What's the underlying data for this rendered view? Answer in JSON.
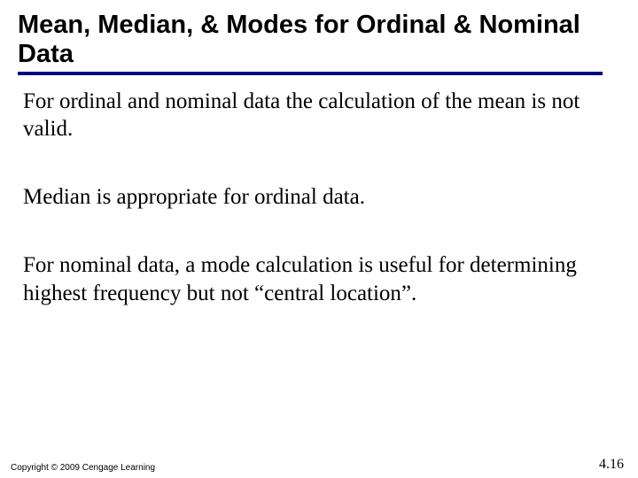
{
  "title": "Mean, Median, & Modes for Ordinal & Nominal Data",
  "paragraphs": {
    "p1": "For ordinal and nominal data the calculation of the mean is not valid.",
    "p2": "Median is appropriate for ordinal data.",
    "p3": "For nominal data, a mode calculation is useful for determining highest frequency but not “central location”."
  },
  "footer": {
    "copyright": "Copyright © 2009 Cengage Learning",
    "page": "4.16"
  }
}
